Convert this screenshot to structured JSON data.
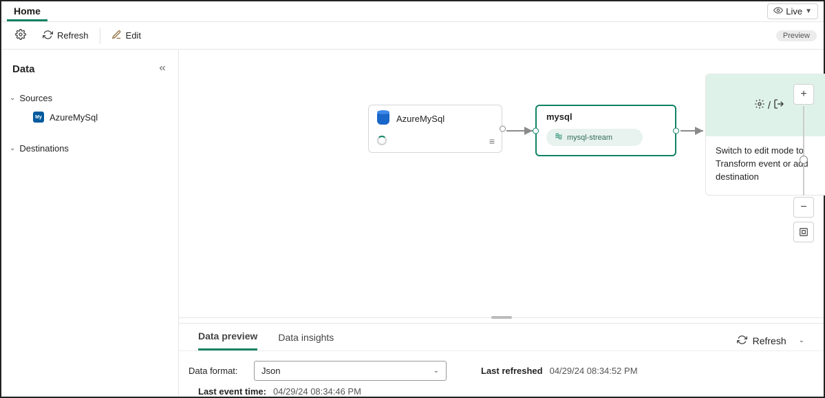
{
  "breadcrumb": {
    "current": "Home"
  },
  "mode_chip": {
    "label": "Live"
  },
  "toolbar": {
    "refresh_label": "Refresh",
    "edit_label": "Edit",
    "preview_badge": "Preview"
  },
  "sidebar": {
    "title": "Data",
    "sources_label": "Sources",
    "source_item": "AzureMySql",
    "destinations_label": "Destinations"
  },
  "canvas": {
    "source_node": {
      "title": "AzureMySql"
    },
    "stream_node": {
      "title": "mysql",
      "pill": "mysql-stream"
    },
    "dest_node": {
      "hint": "Switch to edit mode to Transform event or add destination"
    }
  },
  "bottom": {
    "tab_preview": "Data preview",
    "tab_insights": "Data insights",
    "refresh_label": "Refresh",
    "format_label": "Data format:",
    "format_value": "Json",
    "last_refreshed_label": "Last refreshed",
    "last_refreshed_value": "04/29/24 08:34:52 PM",
    "last_event_label": "Last event time:",
    "last_event_value": "04/29/24 08:34:46 PM"
  }
}
